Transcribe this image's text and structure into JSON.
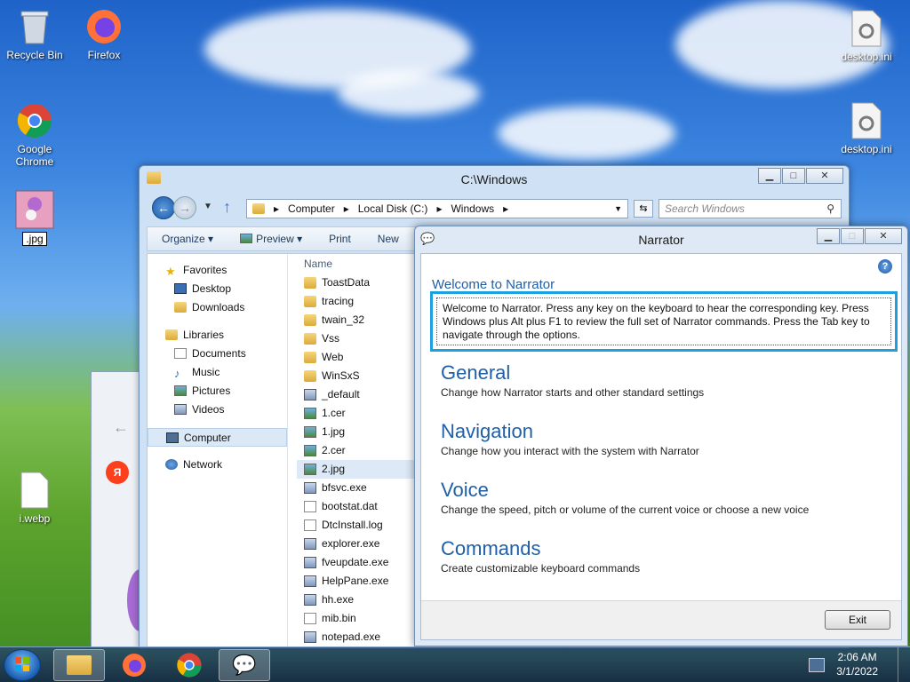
{
  "desktop": {
    "icons": [
      {
        "label": "Recycle Bin"
      },
      {
        "label": "Firefox"
      },
      {
        "label": "Google Chrome"
      },
      {
        "label": ".jpg"
      },
      {
        "label": "i.webp"
      },
      {
        "label": "desktop.ini"
      },
      {
        "label": "desktop.ini"
      }
    ]
  },
  "explorer": {
    "title": "C:\\Windows",
    "breadcrumb": [
      "Computer",
      "Local Disk (C:)",
      "Windows"
    ],
    "search_placeholder": "Search Windows",
    "toolbar": {
      "organize": "Organize ▾",
      "preview": "Preview ▾",
      "print": "Print",
      "new": "New"
    },
    "nav": {
      "favorites": "Favorites",
      "desktop": "Desktop",
      "downloads": "Downloads",
      "libraries": "Libraries",
      "documents": "Documents",
      "music": "Music",
      "pictures": "Pictures",
      "videos": "Videos",
      "computer": "Computer",
      "network": "Network"
    },
    "column_name": "Name",
    "files": [
      "ToastData",
      "tracing",
      "twain_32",
      "Vss",
      "Web",
      "WinSxS",
      "_default",
      "1.cer",
      "1.jpg",
      "2.cer",
      "2.jpg",
      "bfsvc.exe",
      "bootstat.dat",
      "DtcInstall.log",
      "explorer.exe",
      "fveupdate.exe",
      "HelpPane.exe",
      "hh.exe",
      "mib.bin",
      "notepad.exe"
    ]
  },
  "narrator": {
    "title": "Narrator",
    "help": "?",
    "welcome_title": "Welcome to Narrator",
    "welcome_text": "Welcome to Narrator. Press any key on the keyboard to hear the corresponding key. Press Windows plus Alt plus F1 to review the full set of Narrator commands. Press the Tab key to navigate through the options.",
    "sections": [
      {
        "title": "General",
        "desc": "Change how Narrator starts and other standard settings"
      },
      {
        "title": "Navigation",
        "desc": "Change how you interact with the system with Narrator"
      },
      {
        "title": "Voice",
        "desc": "Change the speed, pitch or volume of the current voice or choose a new voice"
      },
      {
        "title": "Commands",
        "desc": "Create customizable keyboard commands"
      }
    ],
    "exit": "Exit"
  },
  "taskbar": {
    "time": "2:06 AM",
    "date": "3/1/2022"
  }
}
